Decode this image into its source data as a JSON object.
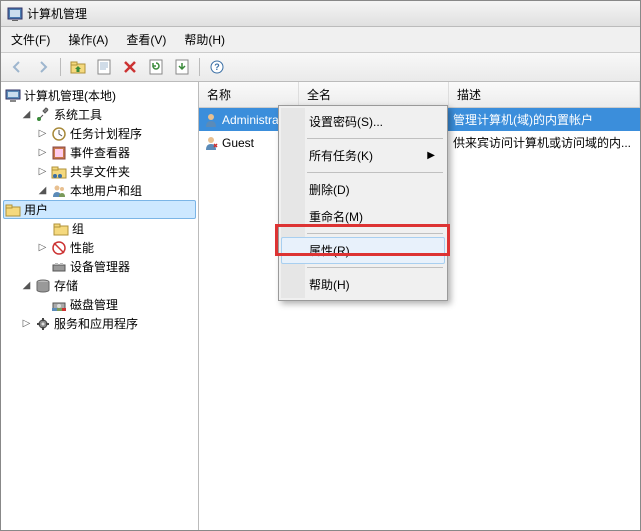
{
  "title": "计算机管理",
  "menubar": [
    {
      "label": "文件(F)"
    },
    {
      "label": "操作(A)"
    },
    {
      "label": "查看(V)"
    },
    {
      "label": "帮助(H)"
    }
  ],
  "tree": {
    "root": "计算机管理(本地)",
    "system_tools": "系统工具",
    "task_sched": "任务计划程序",
    "event_viewer": "事件查看器",
    "shared_folders": "共享文件夹",
    "local_users": "本地用户和组",
    "users": "用户",
    "groups": "组",
    "performance": "性能",
    "device_mgr": "设备管理器",
    "storage": "存储",
    "disk_mgmt": "磁盘管理",
    "services_apps": "服务和应用程序"
  },
  "columns": {
    "name": "名称",
    "fullname": "全名",
    "desc": "描述"
  },
  "rows": [
    {
      "name": "Administrat",
      "fullname": "",
      "desc": "管理计算机(域)的内置帐户",
      "selected": true
    },
    {
      "name": "Guest",
      "fullname": "",
      "desc": "供来宾访问计算机或访问域的内...",
      "selected": false
    }
  ],
  "context_menu": {
    "set_password": "设置密码(S)...",
    "all_tasks": "所有任务(K)",
    "delete": "删除(D)",
    "rename": "重命名(M)",
    "properties": "属性(R)",
    "help": "帮助(H)"
  }
}
